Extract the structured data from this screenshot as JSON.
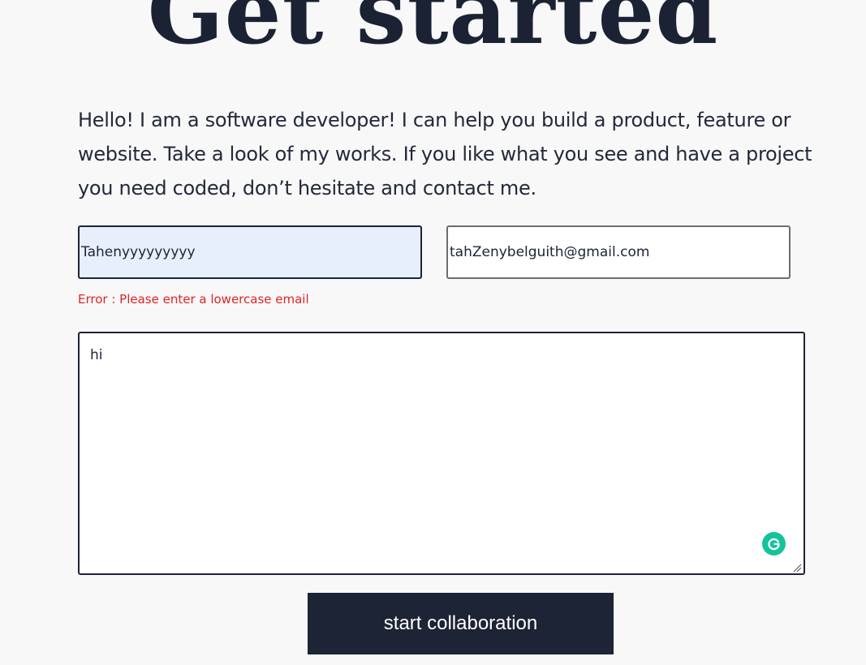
{
  "header": {
    "title": "Get started"
  },
  "intro": {
    "text": "Hello! I am a software developer! I can help you build a product, feature or website. Take a look of my works. If you like what you see and have a project you need coded, don’t hesitate and contact me."
  },
  "form": {
    "name_value": "Tahenyyyyyyyyy",
    "email_value": "tahZenybelguith@gmail.com",
    "error_text": "Error : Please enter a lowercase email",
    "message_value": "hi",
    "submit_label": "start collaboration"
  },
  "icons": {
    "grammarly": "grammarly-icon",
    "resize": "resize-handle-icon"
  },
  "colors": {
    "background": "#f8f8f8",
    "primary": "#1c2436",
    "error": "#e02424",
    "autofill": "#e8effc",
    "grammarly": "#15c39a"
  }
}
